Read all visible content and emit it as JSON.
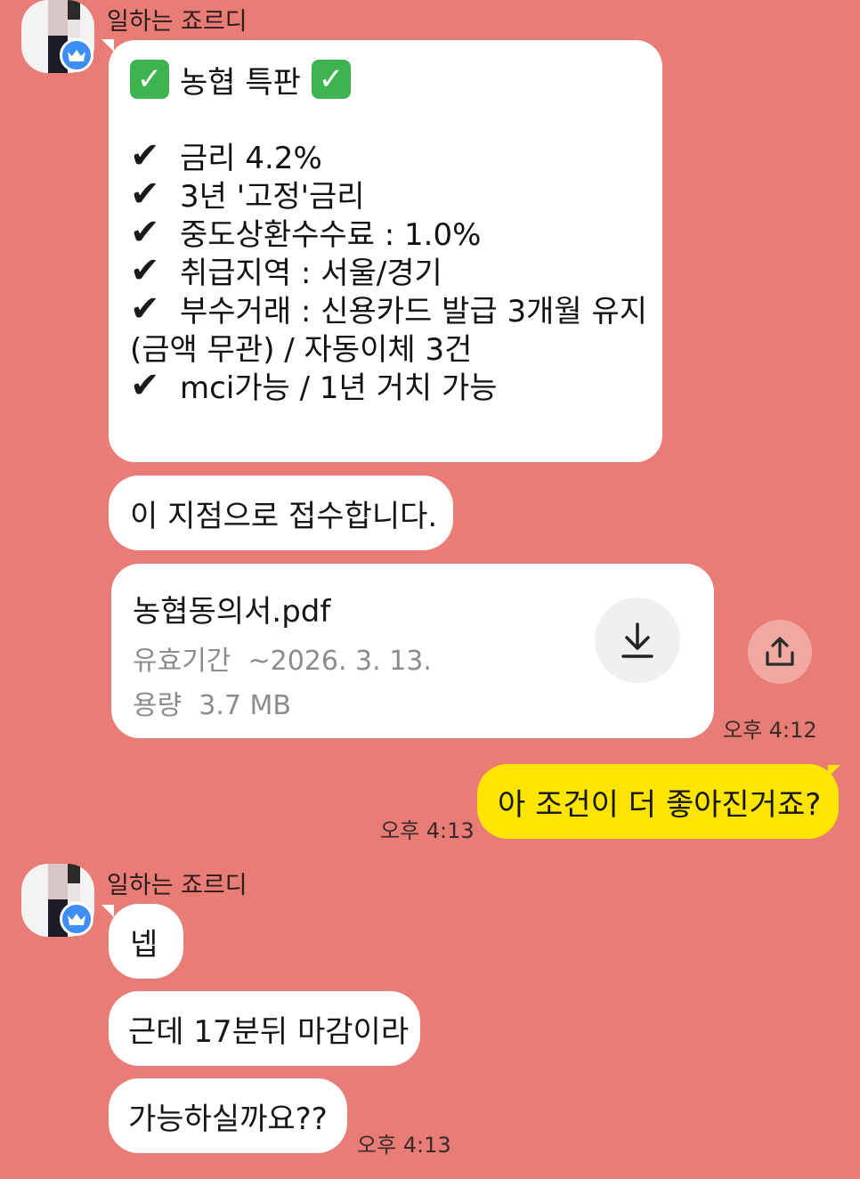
{
  "sender": {
    "name": "일하는 죠르디"
  },
  "promo": {
    "title": "농협 특판",
    "lines": [
      {
        "mark": "✔",
        "text": "금리 4.2%"
      },
      {
        "mark": "✔",
        "text": "3년 '고정'금리"
      },
      {
        "mark": "✔",
        "text": "중도상환수수료 : 1.0%"
      },
      {
        "mark": "✔",
        "text": "취급지역 : 서울/경기"
      },
      {
        "mark": "✔",
        "text": "부수거래 : 신용카드 발급 3개월 유지"
      },
      {
        "mark": "",
        "text": "(금액 무관) / 자동이체 3건"
      },
      {
        "mark": "✔",
        "text": "mci가능 / 1년 거치 가능"
      }
    ]
  },
  "messages": {
    "branch": "이 지점으로 접수합니다.",
    "yes": "넵",
    "deadline": "근데 17분뒤 마감이라",
    "possible": "가능하실까요??",
    "reply": "아 조건이 더 좋아진거죠?"
  },
  "file": {
    "name": "농협동의서.pdf",
    "expiry_label": "유효기간",
    "expiry_value": "~2026. 3. 13.",
    "size_label": "용량",
    "size_value": "3.7 MB",
    "download_icon": "download-icon",
    "share_icon": "share-icon"
  },
  "times": {
    "file_time": "오후 4:12",
    "reply_time": "오후 4:13",
    "last_time": "오후 4:13"
  },
  "colors": {
    "background": "#E97C74",
    "my_bubble": "#FEE500",
    "their_bubble": "#FFFFFF",
    "badge": "#3D8EF5",
    "check_green": "#3FB34F"
  }
}
